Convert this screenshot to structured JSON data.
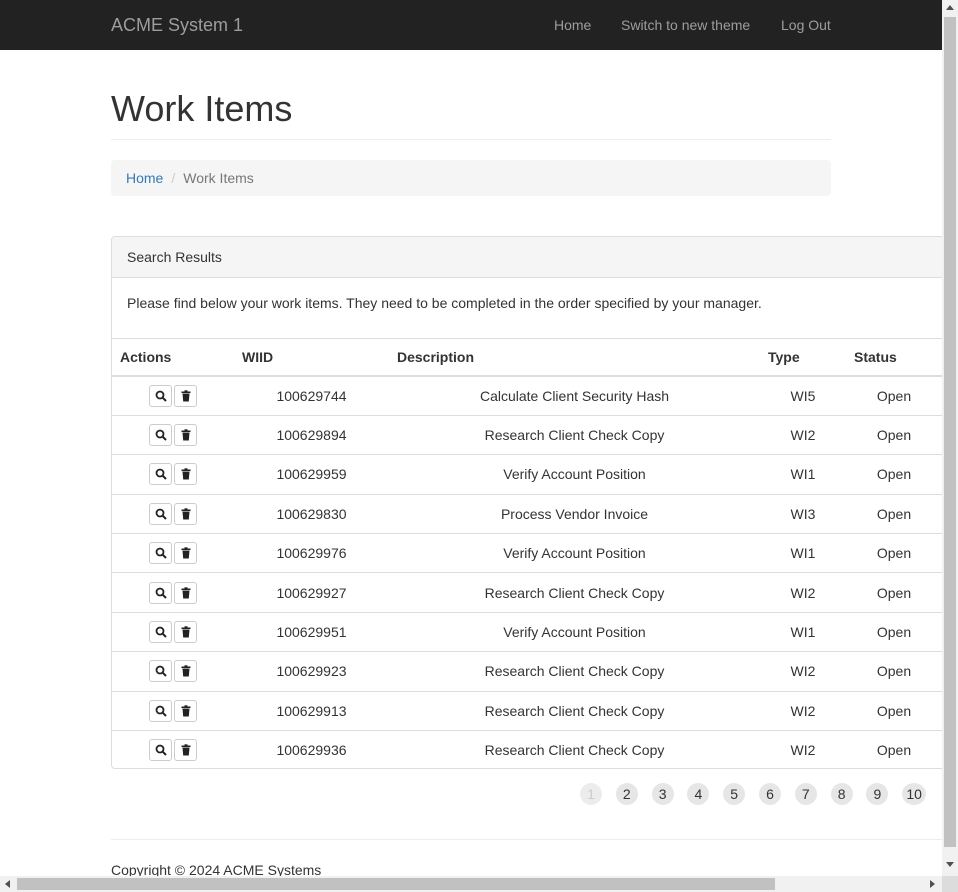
{
  "navbar": {
    "brand": "ACME System 1",
    "links": [
      "Home",
      "Switch to new theme",
      "Log Out"
    ]
  },
  "page": {
    "title": "Work Items"
  },
  "breadcrumb": {
    "home": "Home",
    "separator": "/",
    "current": "Work Items"
  },
  "panel": {
    "heading": "Search Results",
    "body": "Please find below your work items. They need to be completed in the order specified by your manager."
  },
  "table": {
    "headers": [
      "Actions",
      "WIID",
      "Description",
      "Type",
      "Status"
    ],
    "rows": [
      {
        "wiid": "100629744",
        "description": "Calculate Client Security Hash",
        "type": "WI5",
        "status": "Open"
      },
      {
        "wiid": "100629894",
        "description": "Research Client Check Copy",
        "type": "WI2",
        "status": "Open"
      },
      {
        "wiid": "100629959",
        "description": "Verify Account Position",
        "type": "WI1",
        "status": "Open"
      },
      {
        "wiid": "100629830",
        "description": "Process Vendor Invoice",
        "type": "WI3",
        "status": "Open"
      },
      {
        "wiid": "100629976",
        "description": "Verify Account Position",
        "type": "WI1",
        "status": "Open"
      },
      {
        "wiid": "100629927",
        "description": "Research Client Check Copy",
        "type": "WI2",
        "status": "Open"
      },
      {
        "wiid": "100629951",
        "description": "Verify Account Position",
        "type": "WI1",
        "status": "Open"
      },
      {
        "wiid": "100629923",
        "description": "Research Client Check Copy",
        "type": "WI2",
        "status": "Open"
      },
      {
        "wiid": "100629913",
        "description": "Research Client Check Copy",
        "type": "WI2",
        "status": "Open"
      },
      {
        "wiid": "100629936",
        "description": "Research Client Check Copy",
        "type": "WI2",
        "status": "Open"
      }
    ],
    "row_actions": [
      "search-icon",
      "trash-icon"
    ]
  },
  "pagination": {
    "pages": [
      "1",
      "2",
      "3",
      "4",
      "5",
      "6",
      "7",
      "8",
      "9",
      "10"
    ],
    "current": "1"
  },
  "footer": {
    "copyright": "Copyright © 2024 ACME Systems"
  },
  "colors": {
    "navbar_bg": "#222222",
    "link": "#337ab7"
  }
}
